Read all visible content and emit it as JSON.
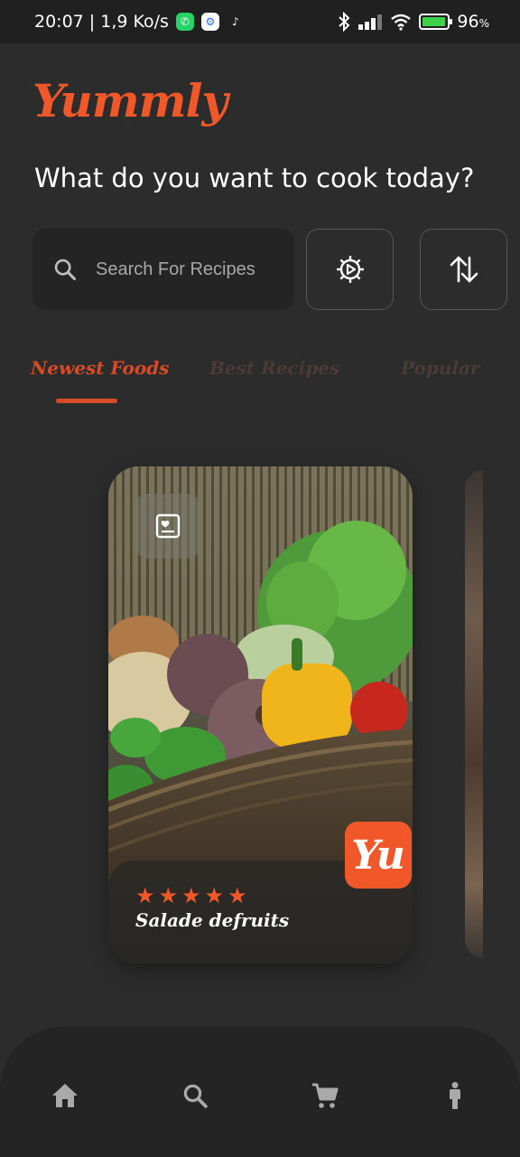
{
  "status_bar": {
    "time_speed": "20:07 | 1,9 Ko/s",
    "battery": "96",
    "battery_unit": "%",
    "battery_level": 0.96
  },
  "header": {
    "logo": "Yummly",
    "headline": "What do you want to cook today?"
  },
  "search": {
    "placeholder": "Search For Recipes"
  },
  "tabs": [
    {
      "label": "Newest Foods",
      "active": true
    },
    {
      "label": "Best Recipes",
      "active": false
    },
    {
      "label": "Popular",
      "active": false
    }
  ],
  "card": {
    "title": "Salade defruits",
    "rating": 5,
    "stars": [
      "★",
      "★",
      "★",
      "★",
      "★"
    ],
    "badge": "Yu"
  },
  "colors": {
    "accent": "#f0582a",
    "background": "#2b2c2b",
    "tab_inactive": "#4a3b36"
  },
  "nav": {
    "items": [
      "home-icon",
      "search-icon",
      "cart-icon",
      "person-icon"
    ]
  }
}
